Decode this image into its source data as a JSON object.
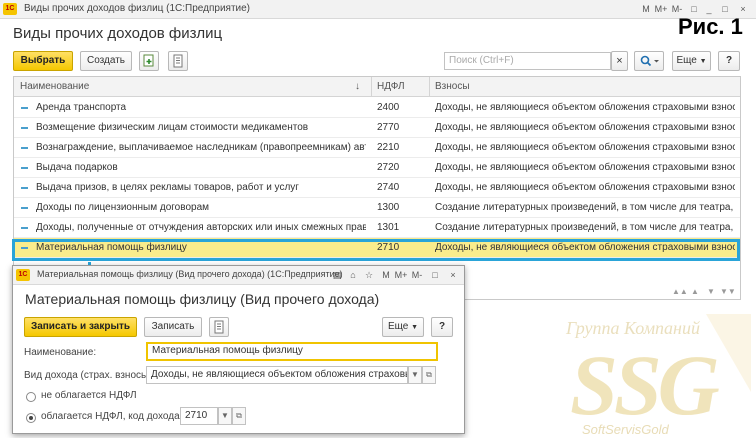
{
  "main_window": {
    "title": "Виды прочих доходов физлиц  (1С:Предприятие)",
    "page_title": "Виды прочих доходов физлиц",
    "controls": [
      "M",
      "M+",
      "M-",
      "□",
      "_",
      "□",
      "×"
    ]
  },
  "figure_caption": "Рис. 1",
  "toolbar": {
    "select_label": "Выбрать",
    "create_label": "Создать",
    "search_placeholder": "Поиск (Ctrl+F)",
    "clear_label": "×",
    "more_label": "Еще",
    "help_label": "?"
  },
  "table": {
    "columns": {
      "name": "Наименование",
      "ndfl": "НДФЛ",
      "contrib": "Взносы"
    },
    "sort_indicator": "↓",
    "rows": [
      {
        "name": "Аренда транспорта",
        "ndfl": "2400",
        "contrib": "Доходы, не являющиеся объектом обложения страховыми взносами"
      },
      {
        "name": "Возмещение физическим лицам стоимости медикаментов",
        "ndfl": "2770",
        "contrib": "Доходы, не являющиеся объектом обложения страховыми взносами"
      },
      {
        "name": "Вознаграждение, выплачиваемое наследникам (правопреемникам) авторов",
        "ndfl": "2210",
        "contrib": "Доходы, не являющиеся объектом обложения страховыми взносами"
      },
      {
        "name": "Выдача подарков",
        "ndfl": "2720",
        "contrib": "Доходы, не являющиеся объектом обложения страховыми взносами"
      },
      {
        "name": "Выдача призов, в целях рекламы товаров, работ и услуг",
        "ndfl": "2740",
        "contrib": "Доходы, не являющиеся объектом обложения страховыми взносами"
      },
      {
        "name": "Доходы по лицензионным договорам",
        "ndfl": "1300",
        "contrib": "Создание литературных произведений, в том числе для театра, кин..."
      },
      {
        "name": "Доходы, полученные от отчуждения авторских или иных смежных прав",
        "ndfl": "1301",
        "contrib": "Создание литературных произведений, в том числе для театра, кин..."
      },
      {
        "name": "Материальная помощь физлицу",
        "ndfl": "2710",
        "contrib": "Доходы, не являющиеся объектом обложения страховыми взносами"
      }
    ],
    "scroll_controls": [
      "▲▲",
      "▲",
      "▼",
      "▼▼"
    ]
  },
  "child_window": {
    "title": "Материальная помощь физлицу (Вид прочего дохода)  (1С:Предприятие)",
    "heading": "Материальная помощь физлицу (Вид прочего дохода)",
    "save_close_label": "Записать и закрыть",
    "save_label": "Записать",
    "more_label": "Еще",
    "help_label": "?",
    "name_label": "Наименование:",
    "name_value": "Материальная помощь физлицу",
    "income_type_label": "Вид дохода (страх. взносы):",
    "income_type_value": "Доходы, не являющиеся объектом обложения страховыми",
    "radio_not_taxed": "не облагается НДФЛ",
    "radio_taxed": "облагается НДФЛ, код дохода:",
    "income_code": "2710",
    "radio_selected": "taxed"
  },
  "watermark": {
    "line1": "Группа Компаний",
    "brand": "SSG",
    "subline": "SoftServisGold"
  },
  "colors": {
    "accent_yellow": "#f5c800",
    "selection_row": "#faec8c",
    "highlight_blue": "#2aa4d8"
  }
}
